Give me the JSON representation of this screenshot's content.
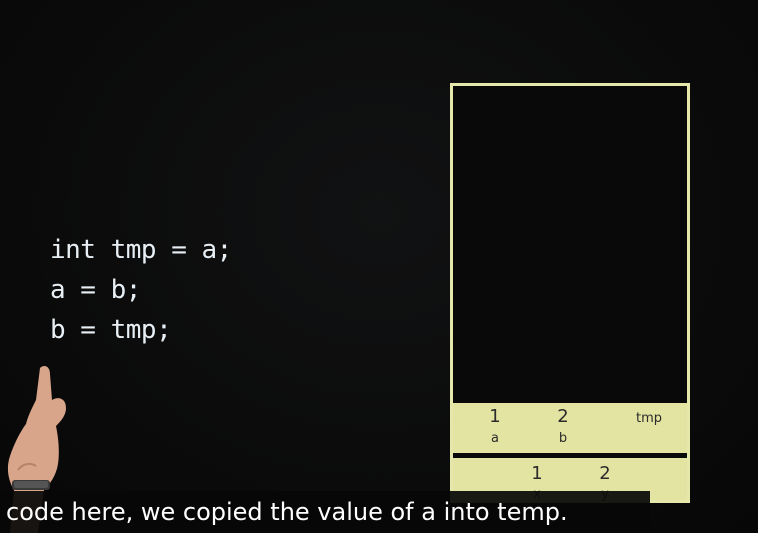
{
  "code": {
    "lines": [
      "int tmp = a;",
      "a = b;",
      "b = tmp;"
    ]
  },
  "stack": {
    "frame_top": {
      "cells": [
        {
          "value": "1",
          "label": "a"
        },
        {
          "value": "2",
          "label": "b"
        },
        {
          "value": "",
          "label": "tmp"
        }
      ]
    },
    "frame_bottom": {
      "cells": [
        {
          "value": "1",
          "label": "x"
        },
        {
          "value": "2",
          "label": "y"
        }
      ]
    }
  },
  "caption": {
    "text": "code here, we copied the value of a into temp."
  },
  "colors": {
    "frame_fill": "#e4e4a2",
    "frame_border": "#e6e7aa",
    "code_text": "#e8f0f6",
    "background": "#0b0b0b"
  }
}
